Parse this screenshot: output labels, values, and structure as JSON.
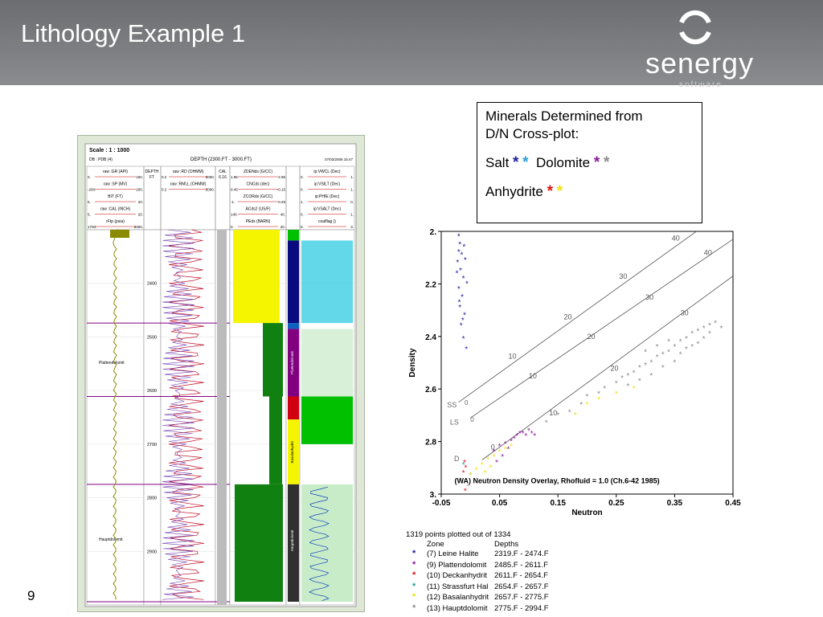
{
  "slide": {
    "title": "Lithology Example 1",
    "page_number": "9",
    "logo_text": "senergy",
    "logo_subtext": "software"
  },
  "minerals_box": {
    "line1": "Minerals Determined from",
    "line2": "D/N Cross-plot:",
    "salt_label": "Salt",
    "dolomite_label": "Dolomite",
    "anhydrite_label": "Anhydrite",
    "star_glyph": "*",
    "salt_colors": [
      "#1a1aa0",
      "#2aa0d8"
    ],
    "dolomite_colors": [
      "#8a1a9a",
      "#8c8c8c"
    ],
    "anhydrite_colors": [
      "#e01010",
      "#f0e010"
    ]
  },
  "log_header": {
    "scale": "Scale : 1 : 1000",
    "db": "DB : PDB (4)",
    "depth_title": "DEPTH (2300.FT - 3000.FT)",
    "date": "07/03/2006 15:47",
    "track1": [
      {
        "name": "raw :GR (API)",
        "min": "0.",
        "max": "150."
      },
      {
        "name": "raw :SP (MV)",
        "min": "-200.",
        "max": "200."
      },
      {
        "name": "BIT (FT)",
        "min": "5.",
        "max": "20."
      },
      {
        "name": "raw :CAL (INCH)",
        "min": "5.",
        "max": "20."
      },
      {
        "name": "rFtp (psia)",
        "min": "1700.",
        "max": "2000."
      }
    ],
    "depth_track": {
      "line1": "DEPTH",
      "line2": "FT"
    },
    "track2": [
      {
        "name": "raw :RD (OHMM)",
        "min": "0.2",
        "max": "2000."
      },
      {
        "name": "raw :RMLL (OHMM)",
        "min": "0.2",
        "max": "2000."
      }
    ],
    "cal_track": {
      "line1": "CAL",
      "line2": "6.16"
    },
    "track3": [
      {
        "name": "ZDENds (G/CC)",
        "min": "1.95",
        "max": "2.95"
      },
      {
        "name": "CNCds (dec)",
        "min": "0.45",
        "max": "-0.15"
      },
      {
        "name": "ZCORds (G/CC)",
        "min": "-1.",
        "max": "0.25"
      },
      {
        "name": "ACds2 (US/F)",
        "min": "140.",
        "max": "40."
      },
      {
        "name": "PEds (BARN)",
        "min": "0.",
        "max": "20."
      }
    ],
    "track4": [
      {
        "name": "ip:VWCL (Dec)",
        "min": "0.",
        "max": "1."
      },
      {
        "name": "ip:VSILT (Dec)",
        "min": "0.",
        "max": "1."
      },
      {
        "name": "ip:PHIE (Dec)",
        "min": "1.",
        "max": "0."
      },
      {
        "name": "ip:VSALT (Dec)",
        "min": "0.",
        "max": "1."
      },
      {
        "name": "coalflag ()",
        "min": "0.",
        "max": "3."
      }
    ]
  },
  "log_tracks": {
    "depth_labels": [
      "2400",
      "2500",
      "2600",
      "2700",
      "2800",
      "2900"
    ],
    "formation_markers": [
      "Plattendolomit",
      "Hauptdolomit"
    ],
    "zone_labels": [
      "Plattendolomit",
      "Basalanhydrit",
      "Hauptdolomit"
    ],
    "colors": {
      "gr": "#8b8b00",
      "sp": "#20a020",
      "resistivity_deep": "#c0102a",
      "resistivity_shallow": "#7040b0",
      "density_fill": "#f5f500",
      "neutron_fill": "#108010",
      "salt": "#0a0a80",
      "dolomite": "#800080",
      "anhydrite": "#d00010",
      "basal": "#f5f500",
      "plattendolomit": "#00c000",
      "hatch": "#20c8e0"
    }
  },
  "chart_data": {
    "type": "scatter",
    "title": "(WA) Neutron Density Overlay, Rhofluid = 1.0 (Ch.6-42 1985)",
    "xlabel": "Neutron",
    "ylabel": "Density",
    "xlim": [
      -0.05,
      0.45
    ],
    "ylim": [
      3.0,
      2.0
    ],
    "x_ticks": [
      "-0.05",
      "0.05",
      "0.15",
      "0.25",
      "0.35",
      "0.45"
    ],
    "y_ticks": [
      "2.",
      "2.2",
      "2.4",
      "2.6",
      "2.8",
      "3."
    ],
    "overlay_lines": [
      {
        "name": "SS",
        "points": [
          [
            -0.02,
            2.65
          ],
          [
            0.45,
            1.9
          ]
        ],
        "labels": [
          {
            "text": "10",
            "at": [
              0.065,
              2.485
            ]
          },
          {
            "text": "20",
            "at": [
              0.16,
              2.335
            ]
          },
          {
            "text": "30",
            "at": [
              0.255,
              2.18
            ]
          },
          {
            "text": "40",
            "at": [
              0.345,
              2.035
            ]
          }
        ]
      },
      {
        "name": "LS",
        "points": [
          [
            0.0,
            2.71
          ],
          [
            0.45,
            2.03
          ]
        ],
        "labels": [
          {
            "text": "10",
            "at": [
              0.1,
              2.56
            ]
          },
          {
            "text": "20",
            "at": [
              0.2,
              2.41
            ]
          },
          {
            "text": "30",
            "at": [
              0.3,
              2.26
            ]
          },
          {
            "text": "40",
            "at": [
              0.4,
              2.09
            ]
          }
        ]
      },
      {
        "name": "D",
        "points": [
          [
            0.02,
            2.87
          ],
          [
            0.45,
            2.17
          ]
        ],
        "labels": [
          {
            "text": "0",
            "at": [
              0.035,
              2.83
            ]
          },
          {
            "text": "10",
            "at": [
              0.135,
              2.7
            ]
          },
          {
            "text": "20",
            "at": [
              0.24,
              2.53
            ]
          },
          {
            "text": "30",
            "at": [
              0.36,
              2.32
            ]
          }
        ]
      }
    ],
    "lithology_labels": [
      "SS",
      "LS",
      "D",
      "0",
      "0"
    ],
    "series": [
      {
        "name": "(7) Leine Halite",
        "color": "#1a1aa0",
        "points": [
          [
            -0.02,
            2.02
          ],
          [
            -0.018,
            2.05
          ],
          [
            -0.015,
            2.09
          ],
          [
            -0.022,
            2.12
          ],
          [
            -0.017,
            2.15
          ],
          [
            -0.012,
            2.18
          ],
          [
            -0.02,
            2.22
          ],
          [
            -0.014,
            2.25
          ],
          [
            -0.018,
            2.29
          ],
          [
            -0.01,
            2.32
          ],
          [
            -0.016,
            2.36
          ],
          [
            -0.012,
            2.41
          ],
          [
            -0.007,
            2.45
          ],
          [
            -0.02,
            2.08
          ],
          [
            -0.011,
            2.06
          ],
          [
            -0.009,
            2.11
          ],
          [
            -0.023,
            2.16
          ],
          [
            -0.006,
            2.2
          ],
          [
            -0.019,
            2.27
          ],
          [
            -0.013,
            2.34
          ]
        ]
      },
      {
        "name": "(9) Plattendolomit",
        "color": "#8a1a9a",
        "points": [
          [
            0.04,
            2.84
          ],
          [
            0.05,
            2.82
          ],
          [
            0.06,
            2.81
          ],
          [
            0.07,
            2.8
          ],
          [
            0.075,
            2.79
          ],
          [
            0.08,
            2.78
          ],
          [
            0.085,
            2.77
          ],
          [
            0.09,
            2.77
          ],
          [
            0.095,
            2.78
          ],
          [
            0.1,
            2.76
          ],
          [
            0.105,
            2.77
          ],
          [
            0.11,
            2.78
          ],
          [
            0.065,
            2.83
          ],
          [
            0.055,
            2.86
          ],
          [
            0.045,
            2.88
          ]
        ]
      },
      {
        "name": "(10) Deckanhydrit",
        "color": "#e01010",
        "points": [
          [
            -0.01,
            2.88
          ],
          [
            -0.008,
            2.9
          ],
          [
            -0.012,
            2.92
          ],
          [
            -0.005,
            2.94
          ],
          [
            -0.01,
            2.96
          ],
          [
            -0.004,
            2.97
          ],
          [
            -0.009,
            2.99
          ]
        ]
      },
      {
        "name": "(11) Strassfurt Hal",
        "color": "#20a0a0",
        "points": [
          [
            -0.012,
            2.89
          ],
          [
            0.0,
            2.93
          ]
        ]
      },
      {
        "name": "(12) Basalanhydrit",
        "color": "#f0e010",
        "points": [
          [
            0.0,
            2.93
          ],
          [
            0.01,
            2.91
          ],
          [
            0.02,
            2.89
          ],
          [
            0.03,
            2.87
          ],
          [
            0.04,
            2.86
          ],
          [
            0.05,
            2.84
          ],
          [
            0.06,
            2.83
          ],
          [
            0.015,
            2.95
          ],
          [
            0.025,
            2.92
          ],
          [
            0.035,
            2.9
          ],
          [
            0.07,
            2.82
          ],
          [
            0.18,
            2.7
          ],
          [
            0.2,
            2.66
          ],
          [
            0.22,
            2.64
          ],
          [
            0.25,
            2.62
          ],
          [
            0.28,
            2.6
          ]
        ]
      },
      {
        "name": "(13) Hauptdolomit",
        "color": "#8c8c8c",
        "points": [
          [
            0.13,
            2.73
          ],
          [
            0.15,
            2.7
          ],
          [
            0.17,
            2.69
          ],
          [
            0.19,
            2.66
          ],
          [
            0.2,
            2.63
          ],
          [
            0.22,
            2.62
          ],
          [
            0.23,
            2.6
          ],
          [
            0.25,
            2.58
          ],
          [
            0.26,
            2.56
          ],
          [
            0.27,
            2.55
          ],
          [
            0.28,
            2.54
          ],
          [
            0.29,
            2.52
          ],
          [
            0.3,
            2.51
          ],
          [
            0.31,
            2.5
          ],
          [
            0.32,
            2.48
          ],
          [
            0.33,
            2.47
          ],
          [
            0.34,
            2.46
          ],
          [
            0.35,
            2.44
          ],
          [
            0.36,
            2.42
          ],
          [
            0.37,
            2.41
          ],
          [
            0.38,
            2.39
          ],
          [
            0.39,
            2.38
          ],
          [
            0.4,
            2.37
          ],
          [
            0.41,
            2.36
          ],
          [
            0.42,
            2.35
          ],
          [
            0.3,
            2.46
          ],
          [
            0.32,
            2.44
          ],
          [
            0.34,
            2.42
          ],
          [
            0.36,
            2.47
          ],
          [
            0.38,
            2.44
          ],
          [
            0.4,
            2.41
          ],
          [
            0.33,
            2.52
          ],
          [
            0.35,
            2.5
          ],
          [
            0.37,
            2.45
          ],
          [
            0.31,
            2.55
          ],
          [
            0.29,
            2.57
          ],
          [
            0.27,
            2.59
          ],
          [
            0.39,
            2.43
          ],
          [
            0.41,
            2.39
          ],
          [
            0.43,
            2.37
          ]
        ]
      }
    ],
    "summary": {
      "header": "1319 points plotted out of 1334",
      "col_zone": "Zone",
      "col_depths": "Depths",
      "rows": [
        {
          "zone": "(7) Leine Halite",
          "depths": "2319.F - 2474.F",
          "color": "#1a1aa0"
        },
        {
          "zone": "(9) Plattendolomit",
          "depths": "2485.F - 2611.F",
          "color": "#8a1a9a"
        },
        {
          "zone": "(10) Deckanhydrit",
          "depths": "2611.F - 2654.F",
          "color": "#e01010"
        },
        {
          "zone": "(11) Strassfurt Hal",
          "depths": "2654.F - 2657.F",
          "color": "#20a0a0"
        },
        {
          "zone": "(12) Basalanhydrit",
          "depths": "2657.F - 2775.F",
          "color": "#f0e010"
        },
        {
          "zone": "(13) Hauptdolomit",
          "depths": "2775.F - 2994.F",
          "color": "#8c8c8c"
        }
      ]
    }
  }
}
